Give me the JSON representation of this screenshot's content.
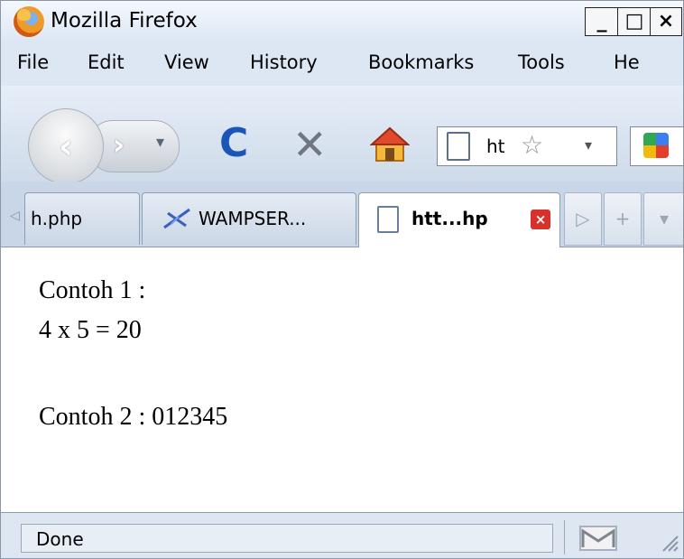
{
  "window": {
    "title": "Mozilla Firefox",
    "min_label": "_",
    "max_label": "□",
    "close_label": "×"
  },
  "menu": [
    {
      "label": "File"
    },
    {
      "label": "Edit"
    },
    {
      "label": "View"
    },
    {
      "label": "History"
    },
    {
      "label": "Bookmarks"
    },
    {
      "label": "Tools"
    },
    {
      "label": "He"
    }
  ],
  "toolbar": {
    "back_glyph": "‹",
    "forward_glyph": "›",
    "history_dropdown_glyph": "▾",
    "reload_glyph": "C",
    "stop_glyph": "✕",
    "url_text": "ht",
    "url_star_glyph": "☆",
    "url_dropdown_glyph": "▾",
    "icons": {
      "back": "back-arrow-icon",
      "forward": "forward-arrow-icon",
      "reload": "reload-icon",
      "stop": "stop-icon",
      "home": "home-icon",
      "search_engine": "google-icon"
    }
  },
  "tabs": [
    {
      "label": "h.php",
      "active": false
    },
    {
      "label": "WAMPSER...",
      "active": false
    },
    {
      "label": "htt...hp",
      "active": true
    }
  ],
  "tab_controls": {
    "scroll_left_glyph": "◁",
    "scroll_right_glyph": "▷",
    "new_tab_glyph": "+",
    "list_glyph": "▾",
    "close_glyph": "×"
  },
  "content": {
    "lines": [
      "Contoh 1 :",
      "4 x 5 = 20",
      "Contoh 2 : 012345"
    ]
  },
  "statusbar": {
    "text": "Done"
  },
  "colors": {
    "accent_blue": "#1a56b8",
    "tab_close_red": "#d7312b",
    "chrome_bg": "#dde7f4"
  }
}
